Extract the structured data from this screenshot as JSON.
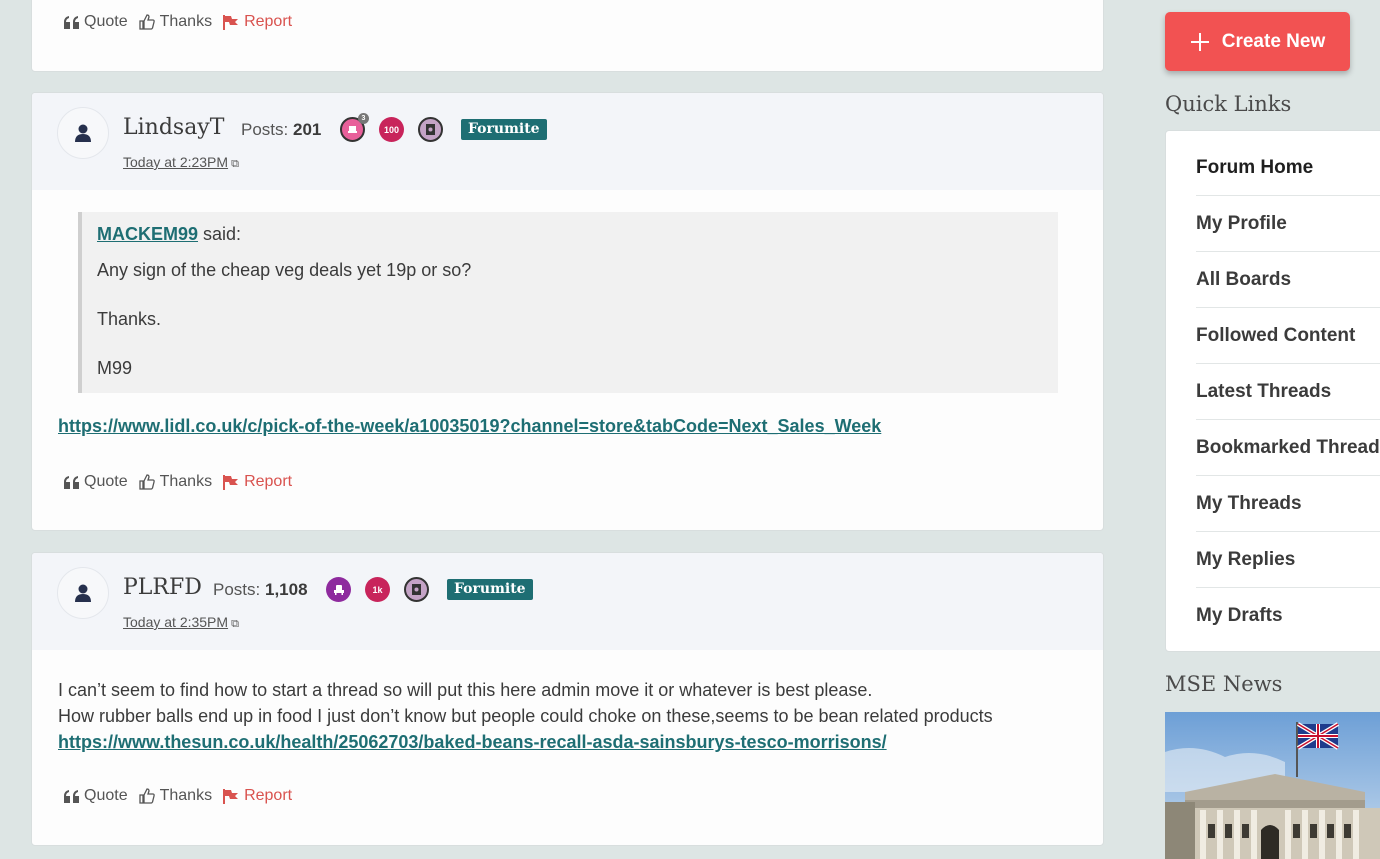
{
  "actions": {
    "quote": "Quote",
    "thanks": "Thanks",
    "report": "Report"
  },
  "posts": [
    {
      "username": "LindsayT",
      "posts_label": "Posts:",
      "posts_count": "201",
      "badges": [
        "3",
        "100",
        ""
      ],
      "rank": "Forumite",
      "time": "Today at 2:23PM",
      "quote": {
        "author": "MACKEM99",
        "said": " said:",
        "lines": [
          "Any sign of the cheap veg deals yet 19p or so?",
          "Thanks.",
          "M99"
        ]
      },
      "link": "https://www.lidl.co.uk/c/pick-of-the-week/a10035019?channel=store&tabCode=Next_Sales_Week"
    },
    {
      "username": "PLRFD",
      "posts_label": "Posts:",
      "posts_count": "1,108",
      "badges": [
        "",
        "1k",
        ""
      ],
      "rank": "Forumite",
      "time": "Today at 2:35PM",
      "lines": [
        "I can’t seem to find how to start a thread so will put this here admin move it or whatever is best please.",
        "How rubber balls end up in food I just don’t know but people could choke on these,seems to be bean related products"
      ],
      "link": "https://www.thesun.co.uk/health/25062703/baked-beans-recall-asda-sainsburys-tesco-morrisons/"
    }
  ],
  "sidebar": {
    "create_label": "Create New",
    "quick_links_title": "Quick Links",
    "quick_links": [
      "Forum Home",
      "My Profile",
      "All Boards",
      "Followed Content",
      "Latest Threads",
      "Bookmarked Threads",
      "My Threads",
      "My Replies",
      "My Drafts"
    ],
    "news_title": "MSE News"
  },
  "colors": {
    "accent": "#1e6e73",
    "create_button": "#f25252",
    "report": "#d9534f"
  }
}
